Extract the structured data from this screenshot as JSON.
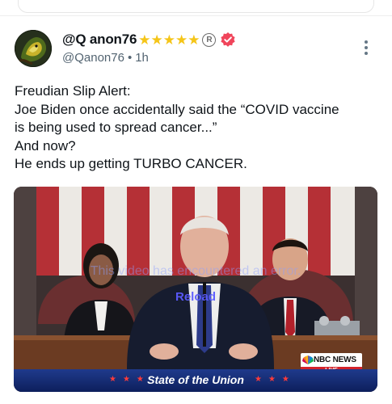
{
  "post": {
    "display_name": "@Q anon76",
    "name_stars": "★★★★★",
    "registered_mark": "R",
    "handle": "@Qanon76",
    "separator": "•",
    "time_ago": "1h",
    "text_lines": [
      "Freudian Slip Alert:",
      "Joe Biden once accidentally said the “COVID vaccine",
      "is being used to spread cancer...”",
      "And now?",
      "He ends up getting TURBO CANCER."
    ]
  },
  "media": {
    "overlay_message": "This video has encountered an error.",
    "reload_label": "Reload",
    "network_logo": "NBC NEWS",
    "network_live": "LIVE",
    "banner_title": "State of the Union",
    "banner_stars": "★★★"
  },
  "icons": {
    "verified": "verified-badge-icon",
    "more": "more-vertical-icon",
    "avatar": "avatar-image"
  },
  "colors": {
    "verified_badge": "#f0455b",
    "star": "#f5c518",
    "reload_link": "#5b5bff",
    "banner_blue": "#1f3a8c",
    "live_red": "#d3222a"
  }
}
